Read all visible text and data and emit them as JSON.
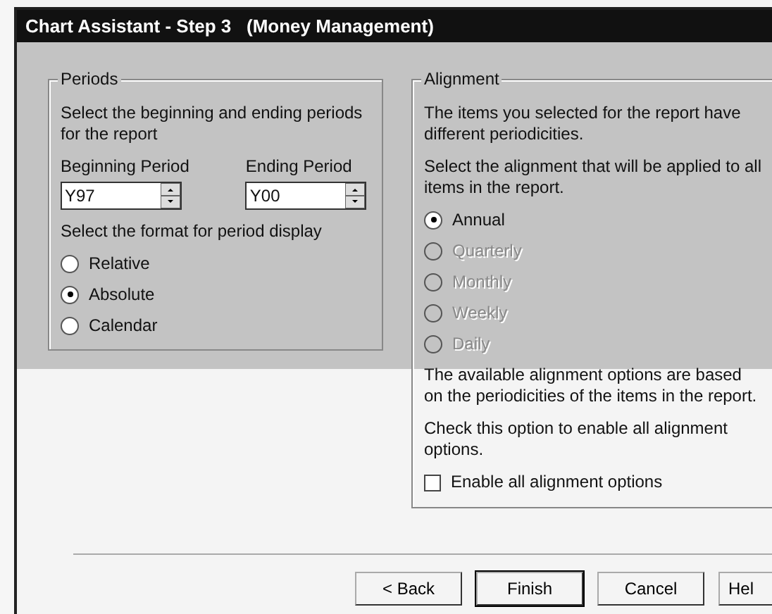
{
  "window": {
    "title": "Chart Assistant - Step 3   (Money Management)"
  },
  "periods": {
    "title": "Periods",
    "intro": "Select the beginning and ending periods for the report",
    "fields": [
      {
        "label": "Beginning Period",
        "value": "Y97"
      },
      {
        "label": "Ending Period",
        "value": "Y00"
      }
    ],
    "format_label": "Select the format for period display",
    "formats": [
      {
        "label": "Relative",
        "selected": false
      },
      {
        "label": "Absolute",
        "selected": true
      },
      {
        "label": "Calendar",
        "selected": false
      }
    ]
  },
  "alignment": {
    "title": "Alignment",
    "intro": "The items you selected for the report have different periodicities.",
    "prompt": "Select the alignment that will be applied to all items in the report.",
    "options": [
      {
        "label": "Annual",
        "selected": true,
        "disabled": false
      },
      {
        "label": "Quarterly",
        "selected": false,
        "disabled": true
      },
      {
        "label": "Monthly",
        "selected": false,
        "disabled": true
      },
      {
        "label": "Weekly",
        "selected": false,
        "disabled": true
      },
      {
        "label": "Daily",
        "selected": false,
        "disabled": true
      }
    ],
    "note": "The available alignment options are based on the periodicities of the items in the report.",
    "check_hint": "Check this option to enable all alignment options.",
    "checkbox": {
      "label": "Enable all alignment options",
      "checked": false
    }
  },
  "buttons": [
    {
      "label": "< Back",
      "default": false
    },
    {
      "label": "Finish",
      "default": true
    },
    {
      "label": "Cancel",
      "default": false
    },
    {
      "label": "Hel",
      "default": false
    }
  ]
}
